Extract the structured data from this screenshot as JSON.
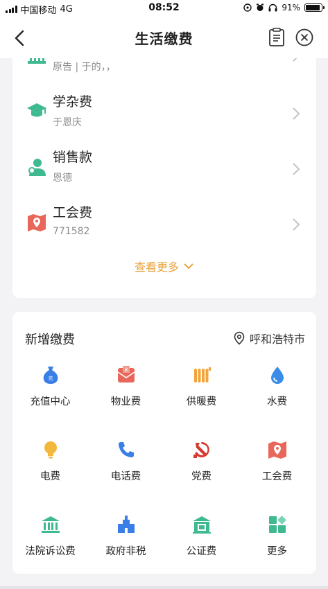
{
  "status_bar": {
    "carrier": "中国移动",
    "network": "4G",
    "time": "08:52",
    "battery": "91%",
    "battery_level": 0.91
  },
  "nav": {
    "title": "生活缴费",
    "back_icon": "back-arrow-icon",
    "records_icon": "clipboard-icon",
    "close_icon": "close-circle-icon"
  },
  "bills": {
    "items": [
      {
        "name": "",
        "subtitle": "原告 | 于的，，",
        "icon": "gate-icon",
        "color": "#3fb98f"
      },
      {
        "name": "学杂费",
        "subtitle": "于恩庆",
        "icon": "graduation-cap-icon",
        "color": "#3fb98f"
      },
      {
        "name": "销售款",
        "subtitle": "恩德",
        "icon": "person-icon",
        "color": "#3fb98f"
      },
      {
        "name": "工会费",
        "subtitle": "771582",
        "icon": "map-pin-icon",
        "color": "#e8675a"
      }
    ],
    "see_more": "查看更多"
  },
  "new_payment": {
    "title": "新增缴费",
    "location": "呼和浩特市",
    "items": [
      {
        "label": "充值中心",
        "icon": "money-bag-icon",
        "color": "#3a7ee8"
      },
      {
        "label": "物业费",
        "icon": "property-envelope-icon",
        "color": "#e8675a"
      },
      {
        "label": "供暖费",
        "icon": "radiator-icon",
        "color": "#f3a43a"
      },
      {
        "label": "水费",
        "icon": "water-drop-icon",
        "color": "#3a8ce8"
      },
      {
        "label": "电费",
        "icon": "light-bulb-icon",
        "color": "#f3b73a"
      },
      {
        "label": "电话费",
        "icon": "phone-icon",
        "color": "#3a7ee8"
      },
      {
        "label": "党费",
        "icon": "party-emblem-icon",
        "color": "#d6372f"
      },
      {
        "label": "工会费",
        "icon": "map-pin-icon",
        "color": "#e8675a"
      },
      {
        "label": "法院诉讼费",
        "icon": "courthouse-icon",
        "color": "#3fb98f"
      },
      {
        "label": "政府非税",
        "icon": "government-building-icon",
        "color": "#3a7ee8"
      },
      {
        "label": "公证费",
        "icon": "notary-building-icon",
        "color": "#3fb98f"
      },
      {
        "label": "更多",
        "icon": "more-grid-icon",
        "color": "#3fb98f"
      }
    ]
  }
}
